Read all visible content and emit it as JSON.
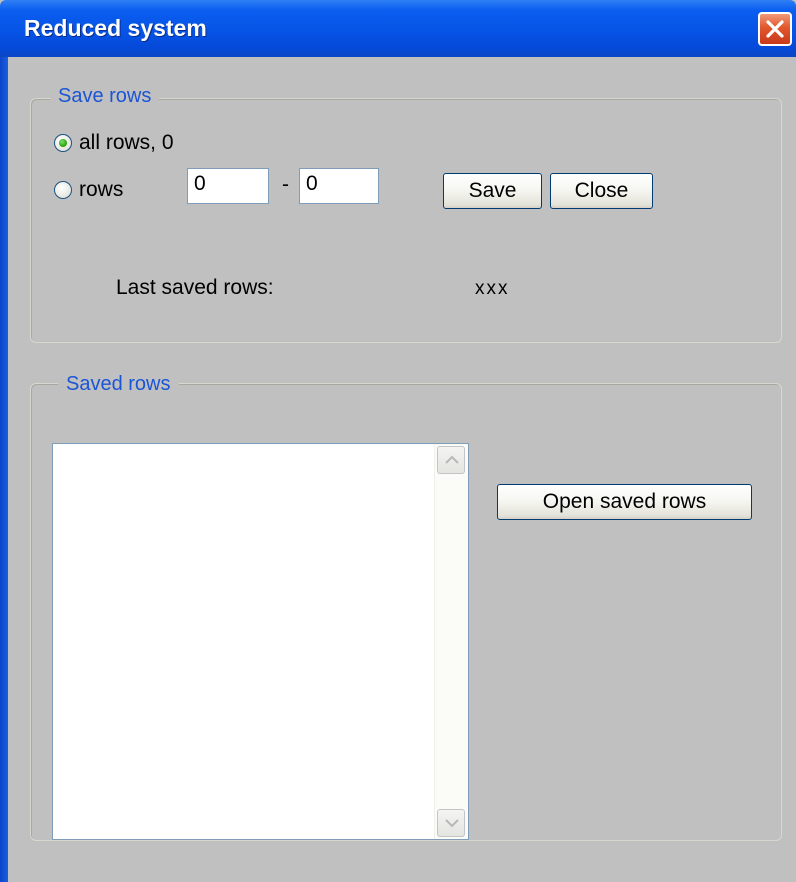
{
  "window": {
    "title": "Reduced system",
    "close_icon": "close-x-icon",
    "close_color": "#e2572d"
  },
  "save_rows": {
    "legend": "Save rows",
    "all_rows_label": "all rows, 0",
    "all_rows_checked": true,
    "rows_label": "rows",
    "rows_checked": false,
    "from_value": "0",
    "separator": "-",
    "to_value": "0",
    "save_button": "Save",
    "close_button": "Close",
    "last_saved_label": "Last saved rows:",
    "last_saved_value": "xxx"
  },
  "saved_rows": {
    "legend": "Saved rows",
    "items": [],
    "open_button": "Open saved rows"
  },
  "colors": {
    "titlebar": "#0754e6",
    "legend_text": "#1a55d6",
    "dialog_background": "#c0c0c0"
  }
}
